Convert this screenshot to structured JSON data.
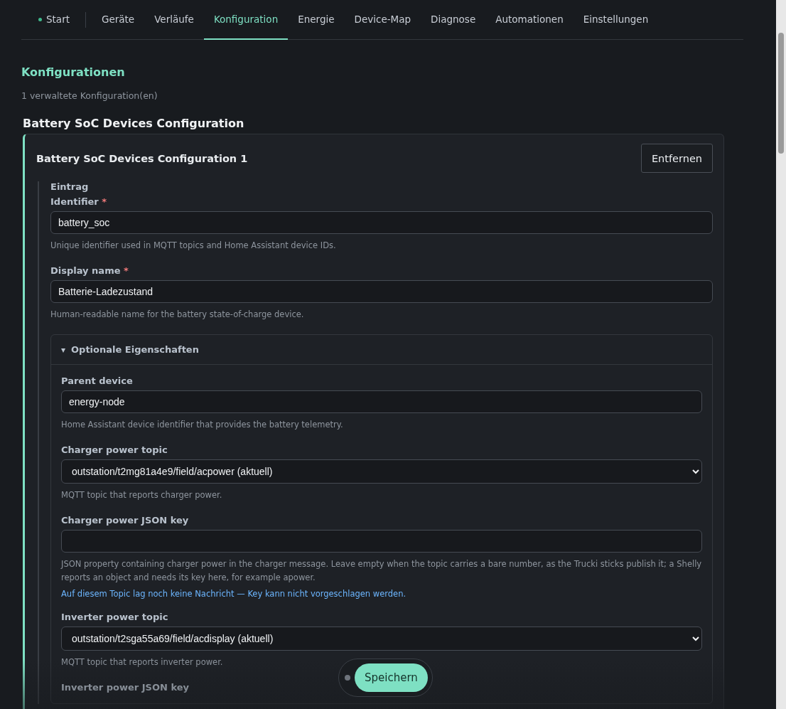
{
  "nav": {
    "tabs": [
      {
        "label": "Start",
        "selected": false,
        "color": "#3fb98c"
      },
      {
        "label": "Geräte",
        "selected": false
      },
      {
        "label": "Verläufe",
        "selected": false
      },
      {
        "label": "Konfiguration",
        "selected": true
      },
      {
        "label": "Energie",
        "selected": false
      },
      {
        "label": "Device-Map",
        "selected": false
      },
      {
        "label": "Diagnose",
        "selected": false
      },
      {
        "label": "Automationen",
        "selected": false
      },
      {
        "label": "Einstellungen",
        "selected": false
      }
    ]
  },
  "page": {
    "title": "Konfigurationen",
    "subtitle": "1 verwaltete Konfiguration(en)"
  },
  "section": {
    "title": "Battery SoC Devices Configuration",
    "card": {
      "title": "Battery SoC Devices Configuration 1",
      "remove_button": "Entfernen",
      "entry_label": "Eintrag",
      "fields": [
        {
          "kind": "text",
          "label": "Identifier",
          "required": true,
          "value": "battery_soc",
          "hint": "Unique identifier used in MQTT topics and Home Assistant device IDs."
        },
        {
          "kind": "text",
          "label": "Display name",
          "required": true,
          "value": "Batterie-Ladezustand",
          "hint": "Human-readable name for the battery state-of-charge device."
        }
      ],
      "required_mark": "*",
      "optional": {
        "toggle": "▾",
        "title": "Optionale Eigenschaften",
        "expanded": true,
        "fields": [
          {
            "kind": "text",
            "label": "Parent device",
            "value": "energy-node",
            "hint": "Home Assistant device identifier that provides the battery telemetry."
          },
          {
            "kind": "select",
            "label": "Charger power topic",
            "value": "outstation/t2mg81a4e9/field/acpower (aktuell)",
            "hint": "MQTT topic that reports charger power."
          },
          {
            "kind": "text",
            "label": "Charger power JSON key",
            "hint": "JSON property containing charger power in the charger message. Leave empty when the topic carries a bare number, as the Trucki sticks publish it; a Shelly reports an object and needs its key here, for example apower.",
            "note": "Auf diesem Topic lag noch keine Nachricht — Key kann nicht vorgeschlagen werden."
          },
          {
            "kind": "select",
            "label": "Inverter power topic",
            "value": "outstation/t2sga55a69/field/acdisplay (aktuell)",
            "hint": "MQTT topic that reports inverter power."
          },
          {
            "kind": "label",
            "label": "Inverter power JSON key"
          }
        ]
      }
    }
  },
  "save_bar": {
    "button": "Speichern",
    "dirty": false
  }
}
